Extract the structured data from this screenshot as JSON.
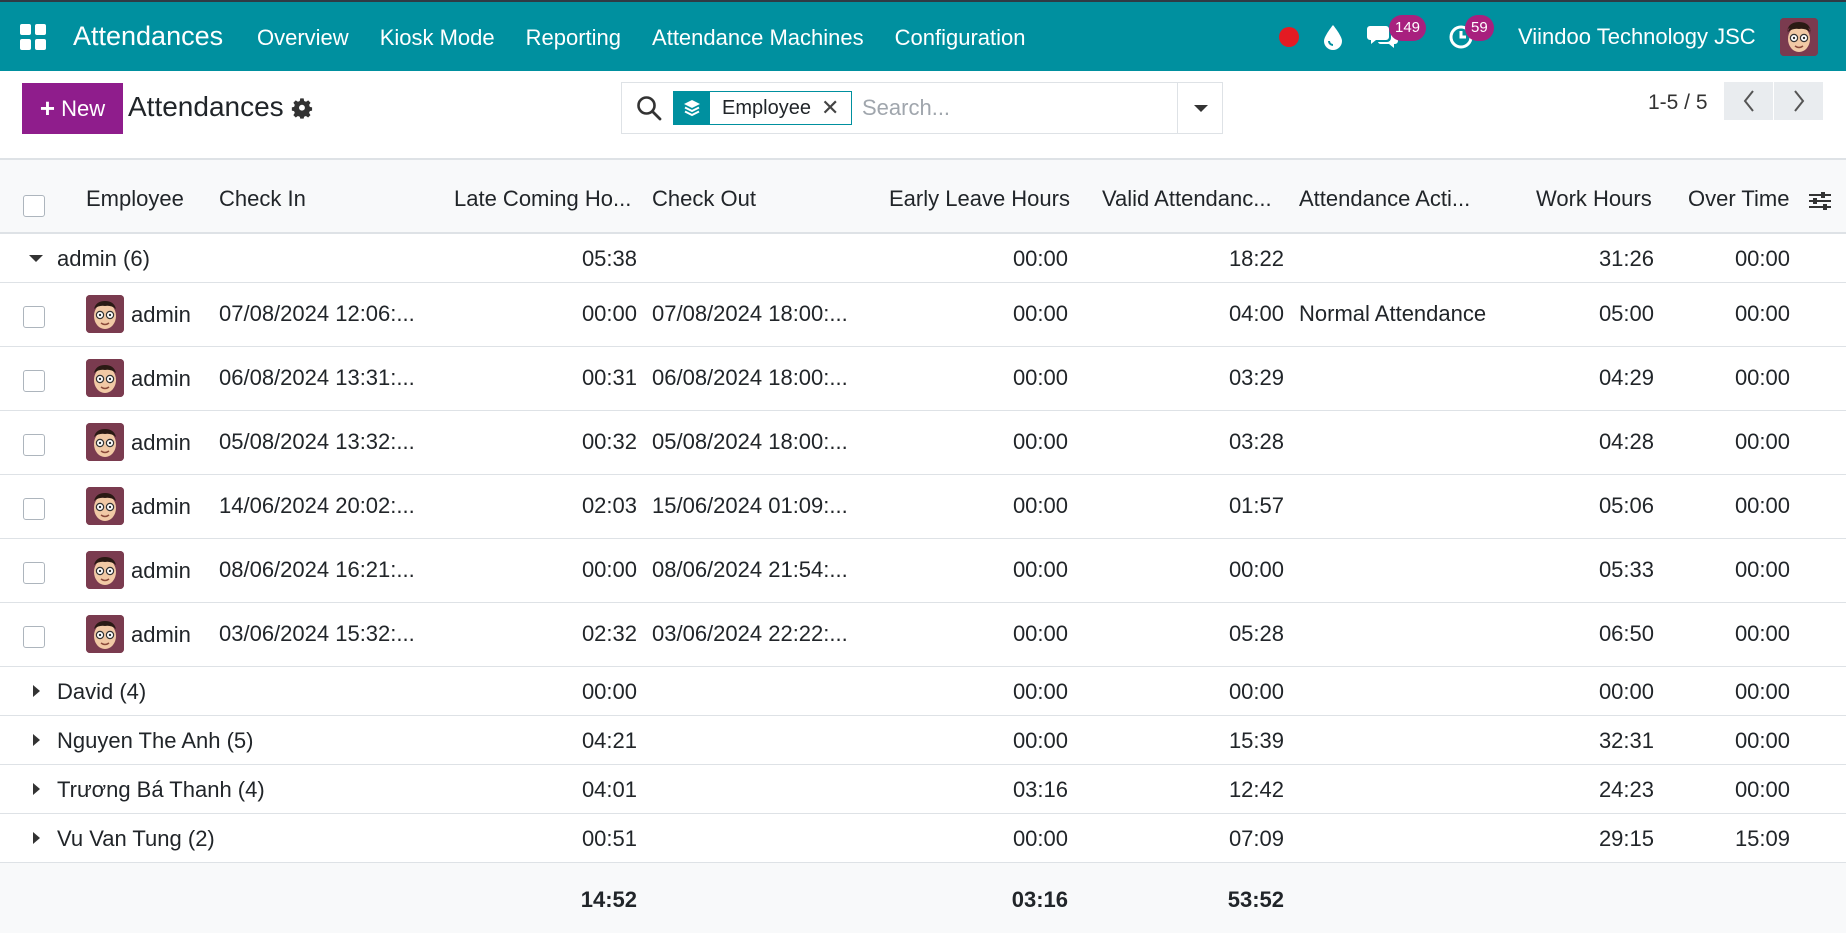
{
  "navbar": {
    "app_title": "Attendances",
    "menu": [
      "Overview",
      "Kiosk Mode",
      "Reporting",
      "Attendance Machines",
      "Configuration"
    ],
    "messages_count": "149",
    "activities_count": "59",
    "company": "Viindoo Technology JSC"
  },
  "control_panel": {
    "new_label": "New",
    "title": "Attendances",
    "facet_label": "Employee",
    "search_placeholder": "Search...",
    "pager": "1-5 / 5"
  },
  "table": {
    "columns": [
      "Employee",
      "Check In",
      "Late Coming Ho...",
      "Check Out",
      "Early Leave Hours",
      "Valid Attendanc...",
      "Attendance Acti...",
      "Work Hours",
      "Over Time"
    ],
    "groups": [
      {
        "label": "admin (6)",
        "late": "05:38",
        "early": "00:00",
        "valid": "18:22",
        "work": "31:26",
        "overtime": "00:00",
        "rows": [
          {
            "employee": "admin",
            "check_in": "07/08/2024 12:06:...",
            "late": "00:00",
            "check_out": "07/08/2024 18:00:...",
            "early": "00:00",
            "valid": "04:00",
            "action": "Normal Attendance",
            "work": "05:00",
            "overtime": "00:00"
          },
          {
            "employee": "admin",
            "check_in": "06/08/2024 13:31:...",
            "late": "00:31",
            "check_out": "06/08/2024 18:00:...",
            "early": "00:00",
            "valid": "03:29",
            "action": "",
            "work": "04:29",
            "overtime": "00:00"
          },
          {
            "employee": "admin",
            "check_in": "05/08/2024 13:32:...",
            "late": "00:32",
            "check_out": "05/08/2024 18:00:...",
            "early": "00:00",
            "valid": "03:28",
            "action": "",
            "work": "04:28",
            "overtime": "00:00"
          },
          {
            "employee": "admin",
            "check_in": "14/06/2024 20:02:...",
            "late": "02:03",
            "check_out": "15/06/2024 01:09:...",
            "early": "00:00",
            "valid": "01:57",
            "action": "",
            "work": "05:06",
            "overtime": "00:00"
          },
          {
            "employee": "admin",
            "check_in": "08/06/2024 16:21:...",
            "late": "00:00",
            "check_out": "08/06/2024 21:54:...",
            "early": "00:00",
            "valid": "00:00",
            "action": "",
            "work": "05:33",
            "overtime": "00:00"
          },
          {
            "employee": "admin",
            "check_in": "03/06/2024 15:32:...",
            "late": "02:32",
            "check_out": "03/06/2024 22:22:...",
            "early": "00:00",
            "valid": "05:28",
            "action": "",
            "work": "06:50",
            "overtime": "00:00"
          }
        ]
      },
      {
        "label": "David (4)",
        "late": "00:00",
        "early": "00:00",
        "valid": "00:00",
        "work": "00:00",
        "overtime": "00:00"
      },
      {
        "label": "Nguyen The Anh (5)",
        "late": "04:21",
        "early": "00:00",
        "valid": "15:39",
        "work": "32:31",
        "overtime": "00:00"
      },
      {
        "label": "Trương Bá Thanh (4)",
        "late": "04:01",
        "early": "03:16",
        "valid": "12:42",
        "work": "24:23",
        "overtime": "00:00"
      },
      {
        "label": "Vu Van Tung (2)",
        "late": "00:51",
        "early": "00:00",
        "valid": "07:09",
        "work": "29:15",
        "overtime": "15:09"
      }
    ],
    "totals": {
      "late": "14:52",
      "early": "03:16",
      "valid": "53:52"
    }
  },
  "colors": {
    "navbar": "#00909f",
    "primary_button": "#8f1d8c",
    "badge": "#a8207e",
    "record": "#e31b23"
  }
}
